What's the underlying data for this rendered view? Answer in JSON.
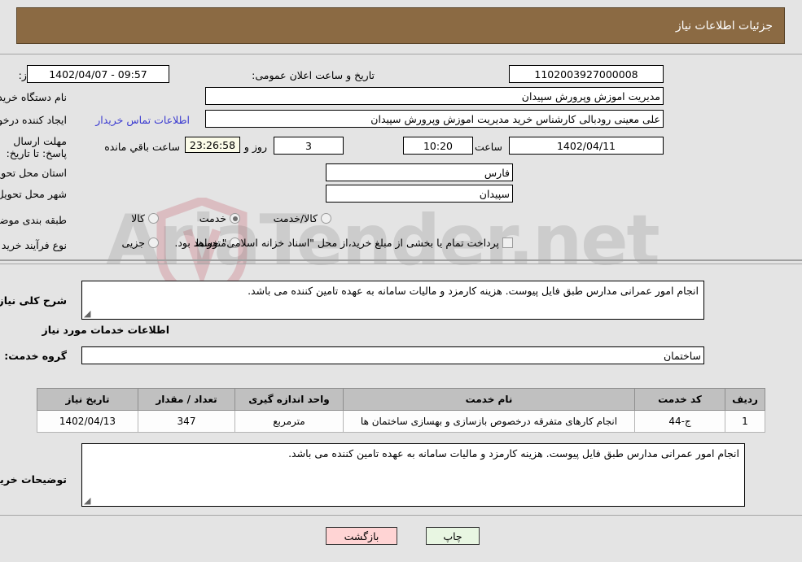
{
  "header": {
    "title": "جزئیات اطلاعات نیاز"
  },
  "form": {
    "need_number_label": "شماره نیاز:",
    "need_number_value": "1102003927000008",
    "public_announce_label": "تاریخ و ساعت اعلان عمومی:",
    "public_announce_value": "1402/04/07 - 09:57",
    "buyer_org_label": "نام دستگاه خریدار:",
    "buyer_org_value": "مدیریت اموزش وپرورش سپیدان",
    "buyer_org_value2": "مدیریت اموزش وپرورش سپیدان",
    "requester_label": "ایجاد کننده درخواست:",
    "requester_value": "علی معینی رودبالی کارشناس خرید مدیریت اموزش وپرورش سپیدان",
    "contact_link": "اطلاعات تماس خریدار",
    "deadline_label": "مهلت ارسال پاسخ: تا تاریخ:",
    "deadline_date": "1402/04/11",
    "hour_label": "ساعت",
    "deadline_time": "10:20",
    "days_value": "3",
    "days_label": "روز و",
    "countdown_value": "23:26:58",
    "remaining_label": "ساعت باقي مانده",
    "province_label": "استان محل تحویل:",
    "province_value": "فارس",
    "city_label": "شهر محل تحویل:",
    "city_value": "سپیدان",
    "category_label": "طبقه بندی موضوعی:",
    "category_options": [
      {
        "label": "کالا",
        "selected": false
      },
      {
        "label": "خدمت",
        "selected": true
      },
      {
        "label": "کالا/خدمت",
        "selected": false
      }
    ],
    "process_label": "نوع فرآیند خرید :",
    "process_options": [
      {
        "label": "جزیی",
        "selected": false
      },
      {
        "label": "متوسط",
        "selected": false
      }
    ],
    "treasury_checkbox_label": "پرداخت تمام یا بخشی از مبلغ خرید،از محل \"اسناد خزانه اسلامی\" خواهد بود.",
    "treasury_checked": false
  },
  "description": {
    "summary_label": "شرح کلی نیاز:",
    "summary_value": "انجام امور عمرانی مدارس طبق فایل پیوست. هزینه کارمزد و مالیات سامانه به عهده تامین کننده می باشد.",
    "services_heading": "اطلاعات خدمات مورد نیاز",
    "service_group_label": "گروه خدمت:",
    "service_group_value": "ساختمان"
  },
  "table": {
    "columns": [
      "ردیف",
      "کد خدمت",
      "نام خدمت",
      "واحد اندازه گیری",
      "تعداد / مقدار",
      "تاریخ نیاز"
    ],
    "rows": [
      {
        "row": "1",
        "code": "ج-44",
        "name": "انجام کارهای متفرقه درخصوص بازسازی و بهسازی ساختمان ها",
        "unit": "مترمربع",
        "qty": "347",
        "date": "1402/04/13"
      }
    ]
  },
  "buyer_notes": {
    "label": "توضیحات خریدار:",
    "value": "انجام امور عمرانی مدارس طبق فایل پیوست. هزینه کارمزد و مالیات سامانه به عهده تامین کننده می باشد."
  },
  "buttons": {
    "print": "چاپ",
    "back": "بازگشت"
  },
  "watermark": {
    "text": "AriaTender.net"
  },
  "colors": {
    "header_bg": "#8b6a43",
    "page_bg": "#e4e4e4",
    "link": "#3a3ad0",
    "table_header_bg": "#c0c0c0",
    "print_btn_bg": "#e8f6e2",
    "back_btn_bg": "#ffd4d4",
    "countdown_bg": "#fbfbe8"
  }
}
